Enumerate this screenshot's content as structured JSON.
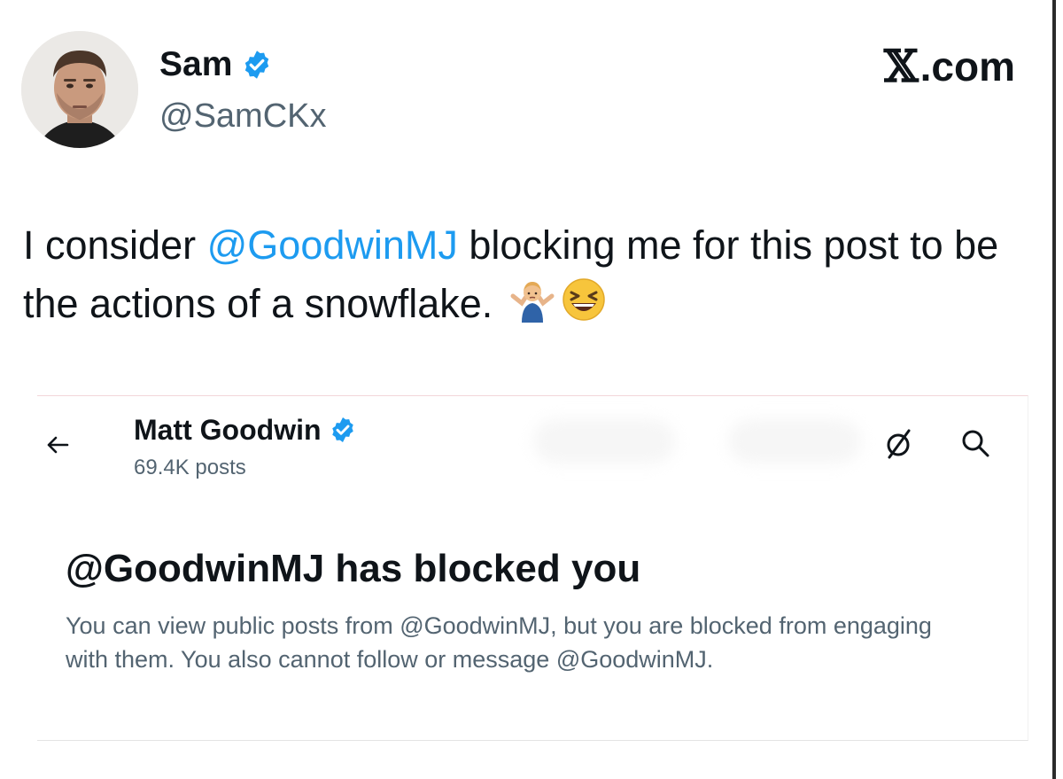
{
  "brand": {
    "text": ".com",
    "icon": "x-logo-icon"
  },
  "author": {
    "name": "Sam",
    "handle": "@SamCKx",
    "verified": true,
    "avatar_icon": "avatar-photo"
  },
  "tweet": {
    "text_before": "I consider ",
    "mention": "@GoodwinMJ",
    "text_after": " blocking me for this post to be the actions of a snowflake. ",
    "emojis": [
      "man-shrugging",
      "grinning-squinting-face"
    ]
  },
  "embedded_screenshot": {
    "profile_name": "Matt Goodwin",
    "verified": true,
    "posts_count": "69.4K posts",
    "blocked_title": "@GoodwinMJ has blocked you",
    "blocked_description": "You can view public posts from @GoodwinMJ, but you are blocked from engaging with them. You also cannot follow or message @GoodwinMJ."
  },
  "colors": {
    "accent": "#1d9bf0",
    "text": "#0f1419",
    "secondary_text": "#536471",
    "verified_badge": "#1d9bf0"
  }
}
